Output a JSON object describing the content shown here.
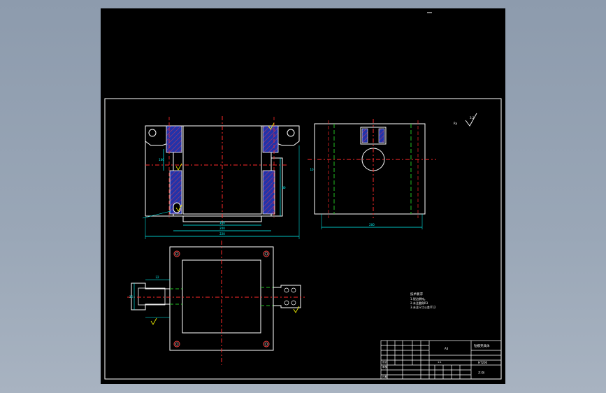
{
  "colors": {
    "background": "#000000",
    "outline": "#ffffff",
    "center_line": "#ff2a2a",
    "hidden_line": "#22c022",
    "dimension": "#00ffff",
    "hatch": "#2233aa",
    "hatch_line": "#ff3b3b",
    "annotation": "#ffff00"
  },
  "annotations": {
    "roughness": "3.2",
    "roughness_left": "Ra",
    "side_label": "10"
  },
  "dimensions": {
    "front_inner": "160",
    "front_mid": "200",
    "front_outer": "220",
    "side_width": "200",
    "left_height": "100",
    "right_height": "80",
    "tab_top": "22",
    "tab_side": "36"
  },
  "notes": {
    "title": "技术要求",
    "line1": "1.锐边倒钝。",
    "line2": "2.未注圆角R3",
    "line3": "3.未注尺寸公差IT12"
  },
  "title_block": {
    "part_name": "钻模夹具体",
    "drawing_no": "A3",
    "material": "HT200",
    "scale": "1:1",
    "sheet": "共1张",
    "designer": "设计",
    "checker": "审核",
    "date": "日期"
  }
}
